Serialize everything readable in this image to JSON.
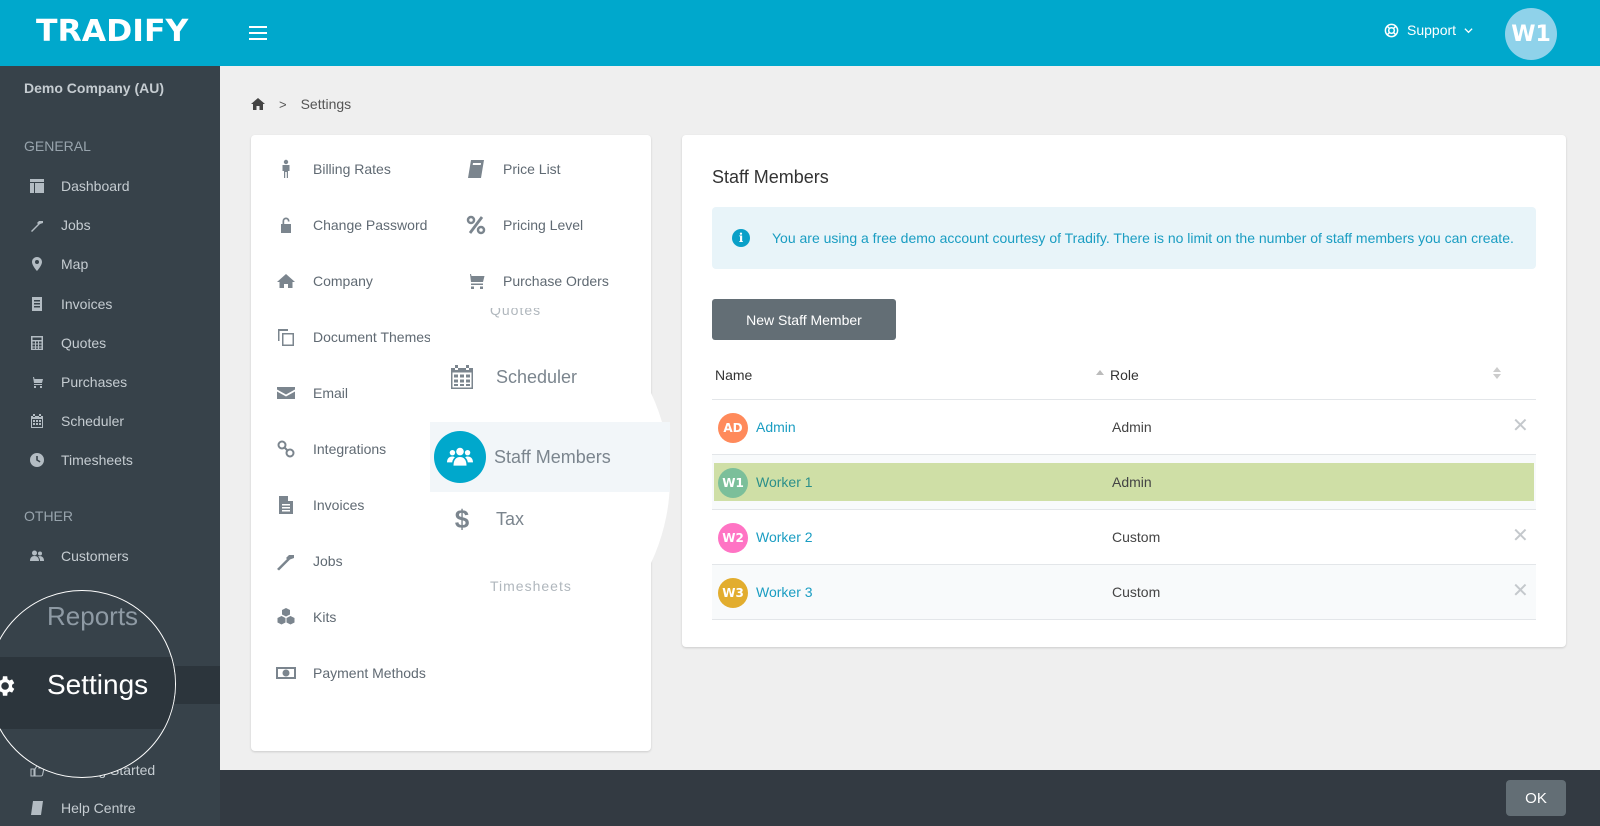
{
  "app": {
    "logo": "TRADIFY"
  },
  "topbar": {
    "support_label": "Support",
    "user_initials": "W1",
    "colors": {
      "brand": "#00a8cc",
      "avatar": "#8fd2ea"
    }
  },
  "sidebar": {
    "company": "Demo Company (AU)",
    "general_label": "GENERAL",
    "general_items": [
      {
        "label": "Dashboard",
        "icon": "dashboard-icon"
      },
      {
        "label": "Jobs",
        "icon": "hammer-icon"
      },
      {
        "label": "Map",
        "icon": "map-pin-icon"
      },
      {
        "label": "Invoices",
        "icon": "invoice-icon"
      },
      {
        "label": "Quotes",
        "icon": "calculator-icon"
      },
      {
        "label": "Purchases",
        "icon": "cart-icon"
      },
      {
        "label": "Scheduler",
        "icon": "calendar-icon"
      },
      {
        "label": "Timesheets",
        "icon": "clock-icon"
      }
    ],
    "other_label": "OTHER",
    "other_items": [
      {
        "label": "Customers",
        "icon": "users-icon"
      },
      {
        "label": "Reports",
        "icon": "chart-icon"
      },
      {
        "label": "Settings",
        "icon": "gear-icon",
        "active": true
      },
      {
        "label": "Getting Started",
        "icon": "thumbs-up-icon"
      },
      {
        "label": "Help Centre",
        "icon": "book-icon"
      }
    ]
  },
  "breadcrumb": {
    "current": "Settings"
  },
  "settings_menu": {
    "left": [
      {
        "label": "Billing Rates",
        "icon": "person-icon"
      },
      {
        "label": "Change Password",
        "icon": "unlock-icon"
      },
      {
        "label": "Company",
        "icon": "home-icon"
      },
      {
        "label": "Document Themes",
        "icon": "copy-icon"
      },
      {
        "label": "Email",
        "icon": "envelope-icon"
      },
      {
        "label": "Integrations",
        "icon": "link-icon"
      },
      {
        "label": "Invoices",
        "icon": "file-icon"
      },
      {
        "label": "Jobs",
        "icon": "hammer-icon"
      },
      {
        "label": "Kits",
        "icon": "cubes-icon"
      },
      {
        "label": "Payment Methods",
        "icon": "money-icon"
      }
    ],
    "right": [
      {
        "label": "Price List",
        "icon": "book-icon"
      },
      {
        "label": "Pricing Level",
        "icon": "percent-icon"
      },
      {
        "label": "Purchase Orders",
        "icon": "cart-icon"
      },
      {
        "label": "Quotes",
        "icon": "calculator-icon"
      },
      {
        "label": "Scheduler",
        "icon": "calendar-icon"
      },
      {
        "label": "Staff Members",
        "icon": "users-icon",
        "active": true
      },
      {
        "label": "Tax",
        "icon": "dollar-icon"
      },
      {
        "label": "Timesheets",
        "icon": "clock-icon"
      }
    ]
  },
  "staff": {
    "title": "Staff Members",
    "alert": "You are using a free demo account courtesy of Tradify. There is no limit on the number of staff members you can create.",
    "new_button": "New Staff Member",
    "columns": [
      "Name",
      "Role"
    ],
    "rows": [
      {
        "initials": "AD",
        "name": "Admin",
        "role": "Admin",
        "color": "#ff8a5b",
        "deletable": true,
        "highlighted": false
      },
      {
        "initials": "W1",
        "name": "Worker 1",
        "role": "Admin",
        "color": "#7bbf9a",
        "deletable": false,
        "highlighted": true
      },
      {
        "initials": "W2",
        "name": "Worker 2",
        "role": "Custom",
        "color": "#ff74c4",
        "deletable": true,
        "highlighted": false
      },
      {
        "initials": "W3",
        "name": "Worker 3",
        "role": "Custom",
        "color": "#e2ad2e",
        "deletable": true,
        "highlighted": false
      }
    ],
    "delete_glyph": "✕"
  },
  "footer": {
    "ok_label": "OK"
  }
}
